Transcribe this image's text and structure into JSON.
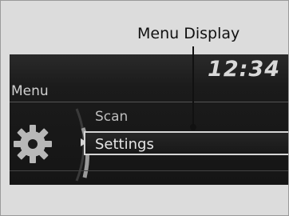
{
  "callout": {
    "label": "Menu Display"
  },
  "display": {
    "clock": "12:34",
    "menu_title": "Menu",
    "items": [
      {
        "label": "Scan",
        "selected": false
      },
      {
        "label": "Settings",
        "selected": true
      }
    ],
    "icons": {
      "category": "gear-icon",
      "selection": "pointer-triangle-icon"
    }
  },
  "colors": {
    "background": "#dcdcdc",
    "screen": "#1b1b1b",
    "text_primary": "#e6e6e6",
    "highlight_border": "#d5d5d5"
  }
}
